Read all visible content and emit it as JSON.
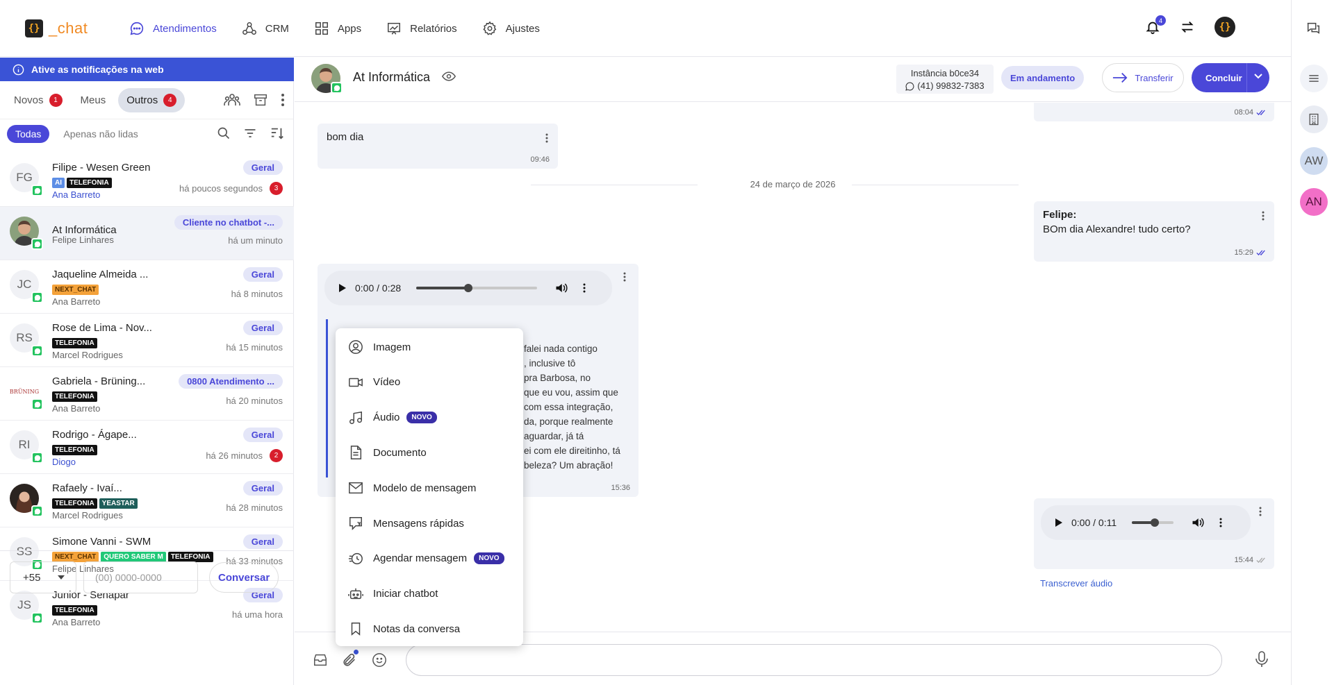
{
  "brand": {
    "logo": "{}",
    "name": "_chat"
  },
  "nav": [
    {
      "label": "Atendimentos",
      "icon": "chat-bubble-icon",
      "active": true
    },
    {
      "label": "CRM",
      "icon": "crm-nodes-icon"
    },
    {
      "label": "Apps",
      "icon": "grid-icon"
    },
    {
      "label": "Relatórios",
      "icon": "report-chart-icon"
    },
    {
      "label": "Ajustes",
      "icon": "gear-icon"
    }
  ],
  "top_right": {
    "bell_count": "4",
    "avatar": "{}"
  },
  "notif_banner": "Ative as notificações na web",
  "tabs": [
    {
      "label": "Novos",
      "badge": "1"
    },
    {
      "label": "Meus"
    },
    {
      "label": "Outros",
      "badge": "4",
      "active": true
    }
  ],
  "filters": [
    {
      "label": "Todas",
      "active": true
    },
    {
      "label": "Apenas não lidas"
    }
  ],
  "conversations": [
    {
      "initials": "FG",
      "name": "Filipe - Wesen Green",
      "tags": [
        {
          "t": "AI",
          "c": "blue"
        },
        {
          "t": "TELEFONIA",
          "c": "black"
        }
      ],
      "agent": "Ana Barreto",
      "agent_blue": true,
      "pill": "Geral",
      "time": "há poucos segundos",
      "badge": "3"
    },
    {
      "initials": "",
      "photo": true,
      "name": "At Informática",
      "tags": [],
      "agent": "Felipe Linhares",
      "pill": "Cliente no chatbot -...",
      "time": "há um minuto",
      "selected": true
    },
    {
      "initials": "JC",
      "name": "Jaqueline Almeida ...",
      "tags": [
        {
          "t": "NEXT_CHAT",
          "c": "orange"
        }
      ],
      "agent": "Ana Barreto",
      "pill": "Geral",
      "time": "há 8 minutos"
    },
    {
      "initials": "RS",
      "name": "Rose de Lima - Nov...",
      "tags": [
        {
          "t": "TELEFONIA",
          "c": "black"
        }
      ],
      "agent": "Marcel Rodrigues",
      "pill": "Geral",
      "time": "há 15 minutos"
    },
    {
      "initials": "BRÜNING",
      "logo": true,
      "name": "Gabriela - Brüning...",
      "tags": [
        {
          "t": "TELEFONIA",
          "c": "black"
        }
      ],
      "agent": "Ana Barreto",
      "pill": "0800 Atendimento ...",
      "time": "há 20 minutos"
    },
    {
      "initials": "RI",
      "name": "Rodrigo - Ágape...",
      "tags": [
        {
          "t": "TELEFONIA",
          "c": "black"
        }
      ],
      "agent": "Diogo",
      "agent_blue": true,
      "pill": "Geral",
      "time": "há 26 minutos",
      "badge": "2"
    },
    {
      "initials": "",
      "photo2": true,
      "name": "Rafaely - Ivaí...",
      "tags": [
        {
          "t": "TELEFONIA",
          "c": "black"
        },
        {
          "t": "YEASTAR",
          "c": "teal"
        }
      ],
      "agent": "Marcel Rodrigues",
      "pill": "Geral",
      "time": "há 28 minutos"
    },
    {
      "initials": "SS",
      "name": "Simone Vanni - SWM",
      "tags": [
        {
          "t": "NEXT_CHAT",
          "c": "orange"
        },
        {
          "t": "QUERO SABER M",
          "c": "green"
        },
        {
          "t": "TELEFONIA",
          "c": "black"
        }
      ],
      "agent": "Felipe Linhares",
      "pill": "Geral",
      "time": "há 33 minutos"
    },
    {
      "initials": "JS",
      "name": "Junior - Senapar",
      "tags": [
        {
          "t": "TELEFONIA",
          "c": "black"
        }
      ],
      "agent": "Ana Barreto",
      "pill": "Geral",
      "time": "há uma hora"
    }
  ],
  "new_chat": {
    "country_code": "+55",
    "phone_placeholder": "(00) 0000-0000",
    "button": "Conversar"
  },
  "chat": {
    "contact_name": "At Informática",
    "instance_label": "Instância b0ce34",
    "instance_phone": "(41) 99832-7383",
    "status": "Em andamento",
    "transfer": "Transferir",
    "conclude": "Concluir"
  },
  "messages": {
    "top_time": "08:04",
    "m1_text": "bom dia",
    "m1_time": "09:46",
    "date_sep": "24 de março de 2026",
    "m2_sender": "Felipe:",
    "m2_text": "BOm dia Alexandre! tudo certo?",
    "m2_time": "15:29",
    "audio1_time": "0:00 / 0:28",
    "audio1_progress": 0.43,
    "quote_lines": [
      "falei nada contigo",
      ", inclusive tô",
      "pra Barbosa, no",
      "que eu vou, assim que",
      "com essa integração,",
      "da, porque realmente",
      "aguardar, já tá",
      "ei com ele direitinho, tá",
      "beleza? Um abração!"
    ],
    "quote_time": "15:36",
    "audio2_time": "0:00 / 0:11",
    "audio2_progress": 0.55,
    "audio2_msg_time": "15:44",
    "transcribe": "Transcrever áudio"
  },
  "attach_menu": [
    {
      "label": "Imagem",
      "icon": "image-person-icon"
    },
    {
      "label": "Vídeo",
      "icon": "video-camera-icon"
    },
    {
      "label": "Áudio",
      "icon": "music-note-icon",
      "novo": "NOVO"
    },
    {
      "label": "Documento",
      "icon": "document-icon"
    },
    {
      "label": "Modelo de mensagem",
      "icon": "envelope-icon"
    },
    {
      "label": "Mensagens rápidas",
      "icon": "quick-message-icon"
    },
    {
      "label": "Agendar mensagem",
      "icon": "schedule-clock-icon",
      "novo": "NOVO"
    },
    {
      "label": "Iniciar chatbot",
      "icon": "robot-icon"
    },
    {
      "label": "Notas da conversa",
      "icon": "bookmark-icon"
    }
  ],
  "right_rail": [
    {
      "label": "",
      "icon": "menu-icon"
    },
    {
      "label": "",
      "icon": "building-icon"
    },
    {
      "label": "AW"
    },
    {
      "label": "AN"
    }
  ],
  "colors": {
    "accent": "#4a47d8",
    "banner": "#3a53d6",
    "badge_red": "#d81e2c",
    "whatsapp": "#22c35e"
  }
}
